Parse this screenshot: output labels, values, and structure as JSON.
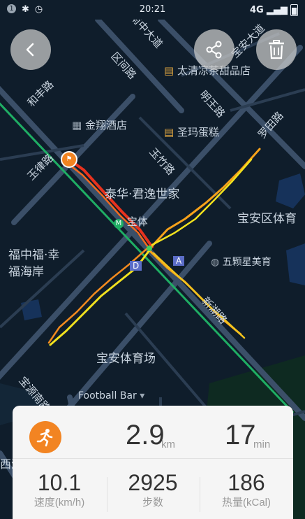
{
  "status_bar": {
    "notif_count": "1",
    "time": "20:21",
    "network": "4G"
  },
  "map": {
    "labels": {
      "rd_jiangnan": "南中大道",
      "rd_quyi": "区间路",
      "rd_yikang": "宝安大道",
      "rd_heping": "和丰路",
      "shop_taiqing": "太清凉茶甜品店",
      "rd_mingwang": "明王路",
      "hotel_jinxiang": "金翔酒店",
      "bakery": "圣玛蛋糕",
      "rd_yuzhu": "玉竹路",
      "rd_luotian": "罗田路",
      "rd_yulv": "玉律路",
      "complex": "泰华·君逸世家",
      "metro_tiyu": "宝体",
      "gym": "宝安区体育",
      "fuzhongfu_1": "福中福·幸",
      "fuzhongfu_2": "福海岸",
      "station_d": "D",
      "station_a": "A",
      "salon": "五颗星美育",
      "rd_xinhu": "新湖路",
      "stadium": "宝安体育场",
      "rd_baoyuan": "宝源南路",
      "football_bar": "Football Bar",
      "garden": "西湾花园"
    }
  },
  "buttons": {
    "back": "back",
    "share": "share",
    "delete": "delete"
  },
  "summary": {
    "distance": "2.9",
    "distance_unit": "km",
    "duration": "17",
    "duration_unit": "min",
    "speed": "10.1",
    "speed_label": "速度(km/h)",
    "steps": "2925",
    "steps_label": "步数",
    "calories": "186",
    "calories_label": "热量(kCal)"
  },
  "colors": {
    "accent": "#f28422",
    "route_start": "#e8321e",
    "route_mid": "#f7a21a",
    "route_end": "#f2e21e",
    "green_line": "#1fae64"
  }
}
